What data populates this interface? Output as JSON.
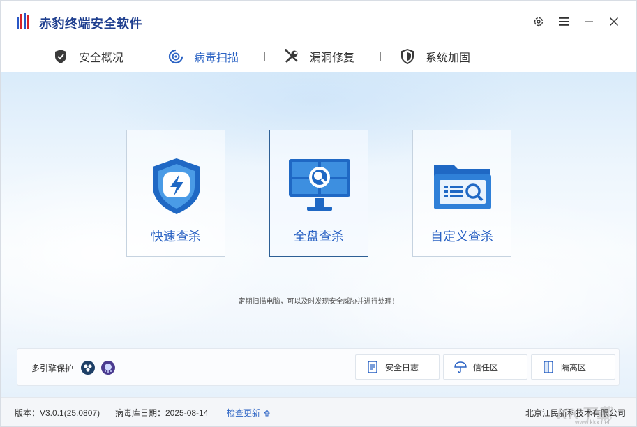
{
  "app": {
    "title": "赤豹终端安全软件",
    "brand_color": "#1f3f8f",
    "accent_color": "#2b63c4"
  },
  "window_controls": [
    {
      "name": "settings-icon"
    },
    {
      "name": "menu-icon"
    },
    {
      "name": "minimize-icon"
    },
    {
      "name": "close-icon"
    }
  ],
  "nav": {
    "tabs": [
      {
        "label": "安全概况",
        "icon": "shield-check-icon",
        "active": false
      },
      {
        "label": "病毒扫描",
        "icon": "scan-radar-icon",
        "active": true
      },
      {
        "label": "漏洞修复",
        "icon": "wrench-screwdriver-icon",
        "active": false
      },
      {
        "label": "系统加固",
        "icon": "shield-reinforce-icon",
        "active": false
      }
    ]
  },
  "scan": {
    "cards": [
      {
        "label": "快速查杀",
        "icon": "lightning-shield-icon",
        "active": false
      },
      {
        "label": "全盘查杀",
        "icon": "monitor-search-icon",
        "active": true
      },
      {
        "label": "自定义查杀",
        "icon": "folder-search-icon",
        "active": false
      }
    ],
    "hint": "定期扫描电脑，可以及时发现安全威胁并进行处理！"
  },
  "panel": {
    "engine_label": "多引擎保护",
    "engines": [
      "engine-a-icon",
      "engine-b-icon"
    ],
    "buttons": [
      {
        "label": "安全日志",
        "icon": "log-icon"
      },
      {
        "label": "信任区",
        "icon": "umbrella-icon"
      },
      {
        "label": "隔离区",
        "icon": "quarantine-icon"
      }
    ]
  },
  "status": {
    "version": "版本：V3.0.1(25.0807)",
    "db_date": "病毒库日期：2025-08-14",
    "check_update": "检查更新",
    "company": "北京江民新科技术有限公司"
  },
  "watermark": {
    "text": "KK下载",
    "url": "www.kkx.net"
  }
}
